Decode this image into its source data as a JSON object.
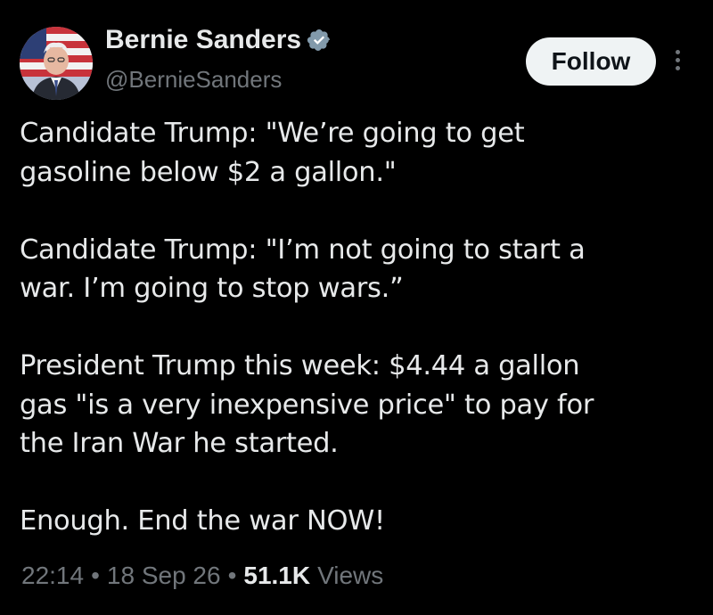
{
  "author": {
    "display_name": "Bernie Sanders",
    "handle": "@BernieSanders",
    "verified": true,
    "verified_color": "#829aab"
  },
  "actions": {
    "follow_label": "Follow",
    "more_icon": "more-vertical-icon"
  },
  "tweet": {
    "lines": [
      "Candidate Trump: \"We’re going to get",
      "gasoline below $2 a gallon.\"",
      "",
      "Candidate Trump: \"I’m not going to start a",
      "war. I’m going to stop wars.”",
      "",
      "President Trump this week: $4.44 a gallon",
      "gas \"is a very inexpensive price\" to pay for",
      "the Iran War he started.",
      "",
      "Enough. End the war NOW!"
    ]
  },
  "meta": {
    "time": "22:14",
    "separator": "•",
    "date": "18 Sep 26",
    "views_count": "51.1K",
    "views_label": "Views"
  },
  "colors": {
    "background": "#000000",
    "text_primary": "#e7e9ea",
    "text_secondary": "#71767b",
    "follow_bg": "#eff3f4",
    "follow_text": "#0f1419"
  }
}
